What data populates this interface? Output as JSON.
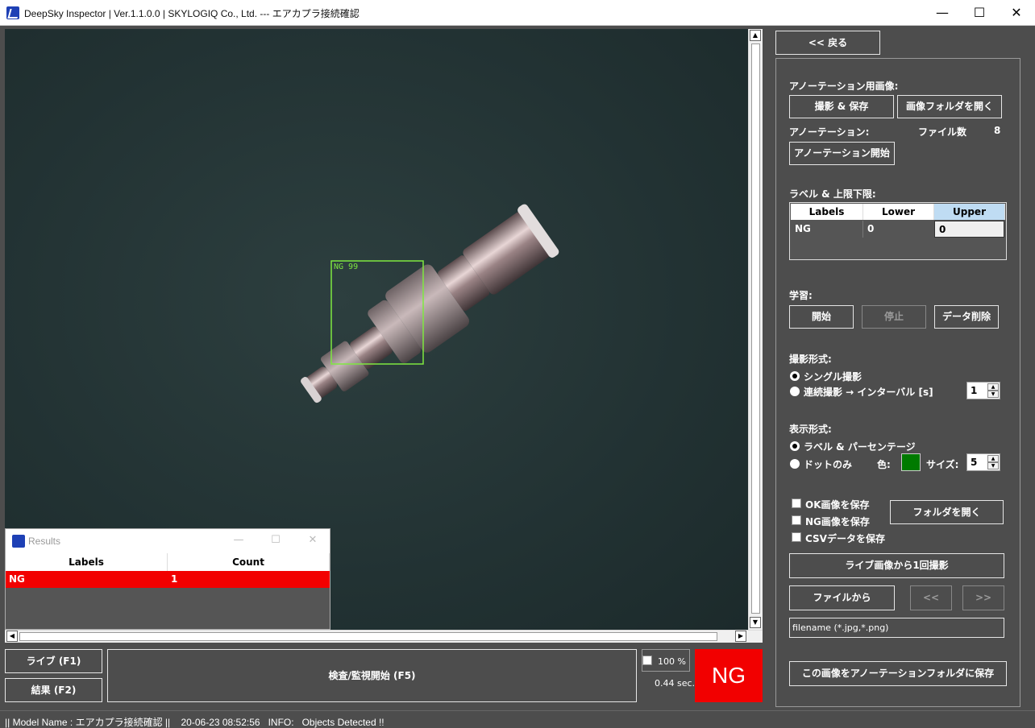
{
  "window": {
    "title": "DeepSky Inspector | Ver.1.1.0.0 | SKYLOGIQ Co., Ltd. --- エアカプラ接続確認",
    "minimize": "—",
    "maximize": "☐",
    "close": "✕"
  },
  "viewer": {
    "detection_label": "NG 99",
    "box_color": "#7fe840"
  },
  "results_window": {
    "title": "Results",
    "columns": [
      "Labels",
      "Count"
    ],
    "rows": [
      {
        "label": "NG",
        "count": "1"
      }
    ],
    "minimize": "—",
    "maximize": "☐",
    "close": "✕"
  },
  "bottom": {
    "live_button": "ライブ (F1)",
    "result_button": "結果 (F2)",
    "inspect_button": "検査/監視開始 (F5)",
    "zoom_percent": "100 %",
    "elapsed": "0.44 sec.",
    "result": "NG",
    "result_color": "#f20000"
  },
  "panel": {
    "back_button": "<< 戻る",
    "annotation_image_label": "アノーテーション用画像:",
    "capture_save_button": "撮影 & 保存",
    "open_image_folder_button": "画像フォルダを開く",
    "annotation_label": "アノーテーション:",
    "file_count_label": "ファイル数",
    "file_count": "8",
    "start_annotation_button": "アノーテーション開始",
    "label_limits_label": "ラベル & 上限下限:",
    "label_table": {
      "columns": [
        "Labels",
        "Lower",
        "Upper"
      ],
      "rows": [
        {
          "label": "NG",
          "lower": "0",
          "upper": "0"
        }
      ]
    },
    "learning_label": "学習:",
    "start_button": "開始",
    "stop_button": "停止",
    "delete_data_button": "データ削除",
    "capture_mode_label": "撮影形式:",
    "single_capture": "シングル撮影",
    "continuous_capture": "連続撮影 → インターバル [s]",
    "interval_value": "1",
    "display_mode_label": "表示形式:",
    "label_percentage": "ラベル & パーセンテージ",
    "dot_only": "ドットのみ",
    "color_label": "色:",
    "dot_color": "#007a00",
    "size_label": "サイズ:",
    "size_value": "5",
    "save_ok_images": "OK画像を保存",
    "save_ng_images": "NG画像を保存",
    "save_csv": "CSVデータを保存",
    "open_folder_button": "フォルダを開く",
    "capture_from_live_button": "ライブ画像から1回撮影",
    "from_file_button": "ファイルから",
    "prev_button": "<<",
    "next_button": ">>",
    "filename_value": "filename (*.jpg,*.png)",
    "save_to_annotation_button": "この画像をアノーテーションフォルダに保存"
  },
  "status_bar": {
    "text": "|| Model Name : エアカプラ接続確認 ||    20-06-23 08:52:56   INFO:   Objects Detected !!"
  }
}
